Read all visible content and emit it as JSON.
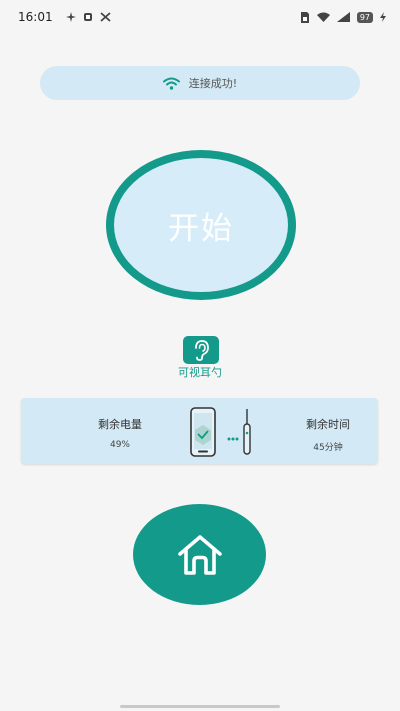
{
  "status_bar": {
    "time": "16:01",
    "battery_level": "97"
  },
  "connection": {
    "label": "连接成功!"
  },
  "start": {
    "label": "开始"
  },
  "device": {
    "name": "可视耳勺"
  },
  "stats": {
    "battery_title": "剩余电量",
    "battery_value": "49%",
    "time_title": "剩余时间",
    "time_value": "45分钟"
  },
  "colors": {
    "accent": "#139a8a",
    "light_blue": "#d3e9f5",
    "background": "#f5f5f5"
  },
  "icons": {
    "wifi": "wifi-icon",
    "ear": "ear-icon",
    "home": "home-icon",
    "phone": "phone-icon",
    "earpick": "earpick-icon"
  }
}
